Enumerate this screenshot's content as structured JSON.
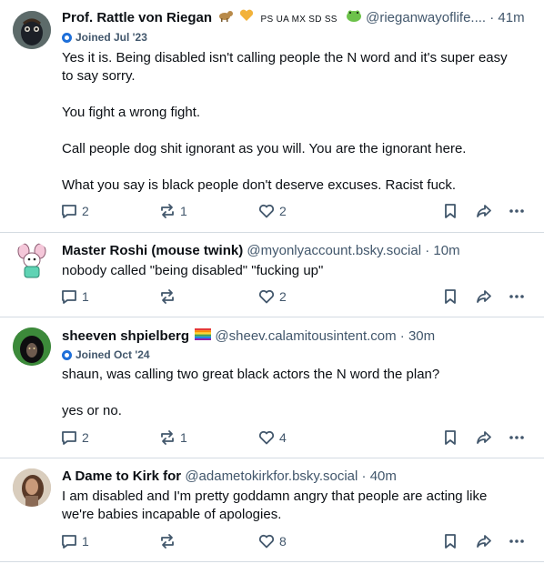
{
  "posts": [
    {
      "author": "Prof. Rattle von Riegan",
      "badges": "PS UA MX SD SS",
      "handle": "@rieganwayoflife....",
      "sep": "·",
      "time": "41m",
      "joined": "Joined Jul '23",
      "paragraphs": [
        "Yes it is. Being disabled isn't calling people the N word and it's super easy to say sorry.",
        "You fight a wrong fight.",
        "Call people dog shit ignorant as you will. You are the ignorant here.",
        "What you say is black people don't deserve excuses.  Racist fuck."
      ],
      "replies": "2",
      "reposts": "1",
      "likes": "2"
    },
    {
      "author": "Master Roshi (mouse twink)",
      "handle": "@myonlyaccount.bsky.social",
      "sep": "·",
      "time": "10m",
      "paragraphs": [
        "nobody called \"being disabled\" \"fucking up\""
      ],
      "replies": "1",
      "reposts": "",
      "likes": "2"
    },
    {
      "author": "sheeven shpielberg",
      "handle": "@sheev.calamitousintent.com",
      "sep": "·",
      "time": "30m",
      "joined": "Joined Oct '24",
      "paragraphs": [
        "shaun, was calling two great black actors the N word the plan?",
        "yes or no."
      ],
      "replies": "2",
      "reposts": "1",
      "likes": "4"
    },
    {
      "author": "A Dame to Kirk for",
      "handle": "@adametokirkfor.bsky.social",
      "sep": "·",
      "time": "40m",
      "paragraphs": [
        "I am disabled and I'm pretty goddamn angry that people are acting like we're babies incapable of apologies."
      ],
      "replies": "1",
      "reposts": "",
      "likes": "8"
    }
  ],
  "colors": {
    "text": "#0b0f14",
    "muted": "#42576c",
    "divider": "#d4dbe2",
    "joined_badge": "#1e6fd9"
  },
  "icons": [
    "reply-icon",
    "repost-icon",
    "like-icon",
    "bookmark-icon",
    "share-icon",
    "more-icon"
  ]
}
